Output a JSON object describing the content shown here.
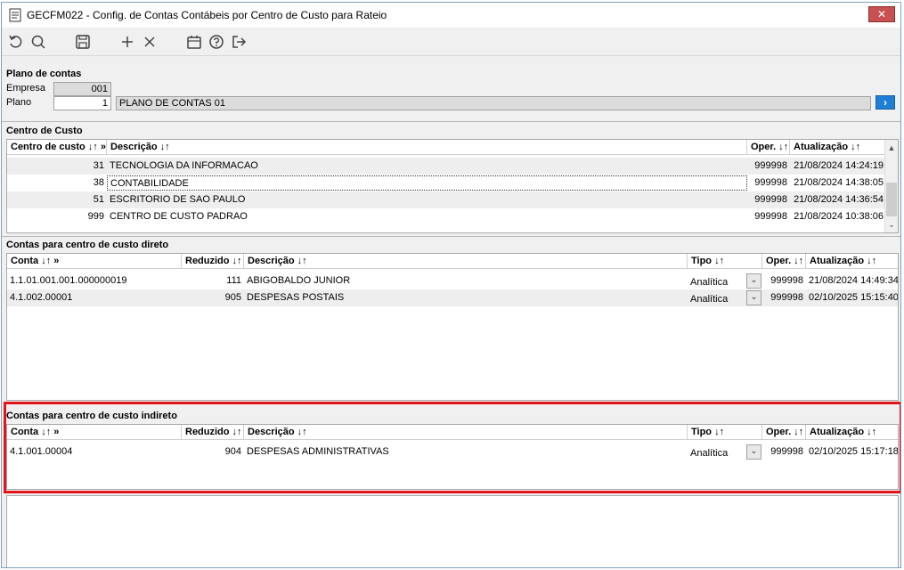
{
  "window": {
    "title": "GECFM022 - Config. de Contas Contábeis por Centro de Custo para Rateio",
    "close_label": "✕"
  },
  "toolbar": {
    "buttons": [
      {
        "name": "undo-icon"
      },
      {
        "name": "search-icon"
      },
      {
        "name": "save-icon"
      },
      {
        "name": "add-icon"
      },
      {
        "name": "delete-icon"
      },
      {
        "name": "calendar-icon"
      },
      {
        "name": "help-icon"
      },
      {
        "name": "exit-icon"
      }
    ]
  },
  "plano_contas": {
    "section_title": "Plano de contas",
    "empresa_label": "Empresa",
    "empresa_value": "001",
    "plano_label": "Plano",
    "plano_value": "1",
    "plano_desc": "PLANO DE CONTAS 01",
    "go_label": "›"
  },
  "centro_custo": {
    "section_title": "Centro de Custo",
    "headers": {
      "codigo": "Centro de custo ↓↑ »",
      "descricao": "Descrição ↓↑",
      "oper": "Oper. ↓↑",
      "atualizacao": "Atualização ↓↑"
    },
    "rows": [
      {
        "codigo": "31",
        "descricao": "TECNOLOGIA DA INFORMACAO",
        "oper": "999998",
        "atualizacao": "21/08/2024 14:24:19"
      },
      {
        "codigo": "38",
        "descricao": "CONTABILIDADE",
        "oper": "999998",
        "atualizacao": "21/08/2024 14:38:05"
      },
      {
        "codigo": "51",
        "descricao": "ESCRITORIO DE SAO PAULO",
        "oper": "999998",
        "atualizacao": "21/08/2024 14:36:54"
      },
      {
        "codigo": "999",
        "descricao": "CENTRO DE CUSTO PADRAO",
        "oper": "999998",
        "atualizacao": "21/08/2024 10:38:06"
      }
    ]
  },
  "contas_direto": {
    "section_title": "Contas para centro de custo direto",
    "headers": {
      "conta": "Conta ↓↑ »",
      "reduzido": "Reduzido ↓↑",
      "descricao": "Descrição ↓↑",
      "tipo": "Tipo ↓↑",
      "oper": "Oper. ↓↑",
      "atualizacao": "Atualização ↓↑"
    },
    "rows": [
      {
        "conta": "1.1.01.001.001.000000019",
        "reduzido": "111",
        "descricao": "ABIGOBALDO JUNIOR",
        "tipo": "Analítica",
        "oper": "999998",
        "atualizacao": "21/08/2024 14:49:34"
      },
      {
        "conta": "4.1.002.00001",
        "reduzido": "905",
        "descricao": "DESPESAS POSTAIS",
        "tipo": "Analítica",
        "oper": "999998",
        "atualizacao": "02/10/2025 15:15:40"
      }
    ]
  },
  "contas_indireto": {
    "section_title": "Contas para centro de custo indireto",
    "headers": {
      "conta": "Conta ↓↑ »",
      "reduzido": "Reduzido ↓↑",
      "descricao": "Descrição ↓↑",
      "tipo": "Tipo ↓↑",
      "oper": "Oper. ↓↑",
      "atualizacao": "Atualização ↓↑"
    },
    "rows": [
      {
        "conta": "4.1.001.00004",
        "reduzido": "904",
        "descricao": "DESPESAS ADMINISTRATIVAS",
        "tipo": "Analítica",
        "oper": "999998",
        "atualizacao": "02/10/2025 15:17:18"
      }
    ]
  },
  "icons": {
    "dropdown": "⌄",
    "scroll_up": "▲",
    "scroll_down": "⌄"
  },
  "colors": {
    "highlight": "#e0161c",
    "go_button": "#1f7fd6",
    "close_button": "#c75050"
  }
}
